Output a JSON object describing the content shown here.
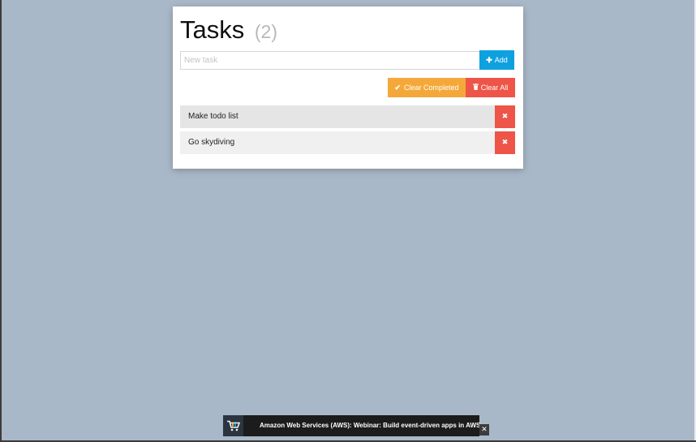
{
  "header": {
    "title": "Tasks",
    "count": "(2)"
  },
  "new_task": {
    "placeholder": "New task",
    "value": ""
  },
  "buttons": {
    "add_label": "Add",
    "add_icon": "plus-icon",
    "clear_completed_label": "Clear Completed",
    "clear_completed_icon": "check-icon",
    "clear_all_label": "Clear All",
    "clear_all_icon": "trash-icon",
    "delete_icon": "close-icon"
  },
  "tasks": [
    {
      "text": "Make todo list"
    },
    {
      "text": "Go skydiving"
    }
  ],
  "banner": {
    "text": "Amazon Web Services (AWS): Webinar: Build event-driven apps in AWS",
    "logo_icon": "shopping-cart-icon",
    "close_icon": "close-icon"
  },
  "colors": {
    "background": "#a9b8c8",
    "add": "#0ea1e0",
    "clear_completed": "#f5a83a",
    "danger": "#ee5448"
  }
}
